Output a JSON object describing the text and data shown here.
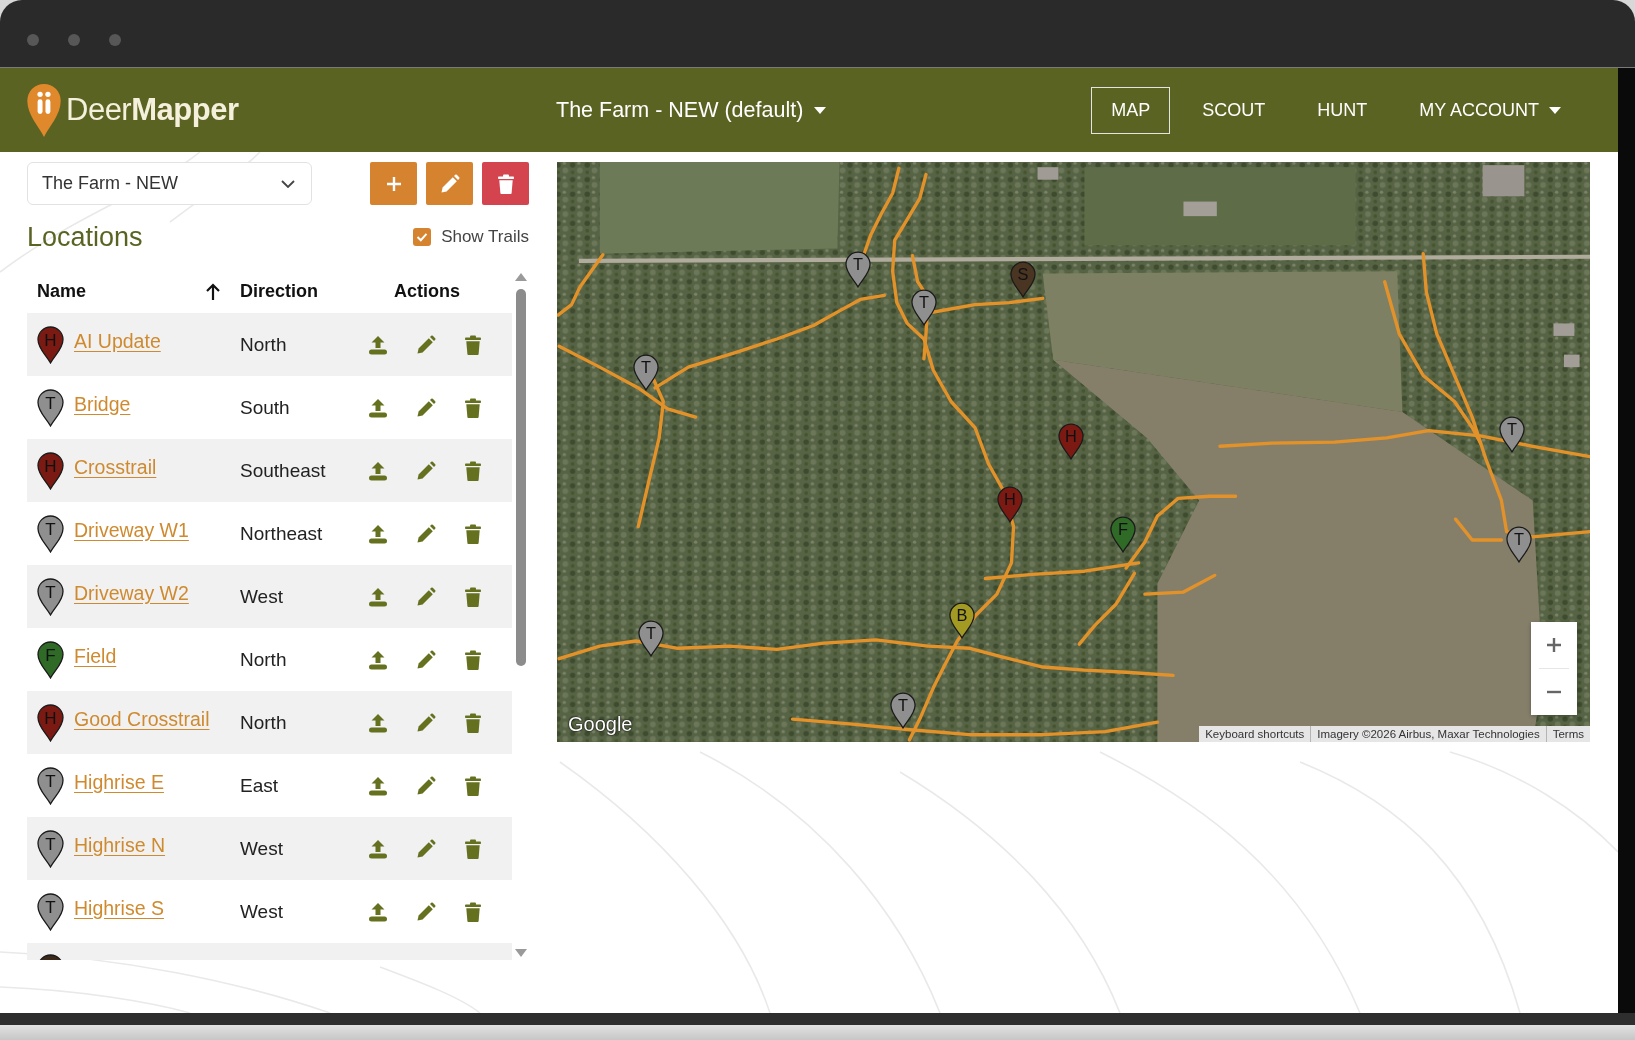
{
  "header": {
    "logo": "Deer**Mapper**",
    "property_dropdown": "The Farm - NEW (default)",
    "nav": [
      {
        "label": "MAP",
        "selected": true,
        "kind": "link"
      },
      {
        "label": "SCOUT",
        "selected": false,
        "kind": "link"
      },
      {
        "label": "HUNT",
        "selected": false,
        "kind": "link"
      },
      {
        "label": "MY ACCOUNT",
        "selected": false,
        "kind": "dropdown"
      }
    ]
  },
  "sidebar": {
    "property_select": {
      "value": "The Farm - NEW"
    },
    "title": "Locations",
    "show_trails": {
      "label": "Show Trails",
      "checked": true
    },
    "table": {
      "columns": [
        {
          "label": "Name",
          "sorted": true
        },
        {
          "label": "Direction",
          "sorted": false
        },
        {
          "label": "Actions",
          "sorted": false
        }
      ],
      "rows": [
        {
          "kind": "full",
          "marker": {
            "letter": "H",
            "color": "#7a1a12"
          },
          "name": "AI Update",
          "direction": "North"
        },
        {
          "kind": "full",
          "marker": {
            "letter": "T",
            "color": "#8f8f8f"
          },
          "name": "Bridge",
          "direction": "South"
        },
        {
          "kind": "full",
          "marker": {
            "letter": "H",
            "color": "#7a1a12"
          },
          "name": "Crosstrail",
          "direction": "Southeast"
        },
        {
          "kind": "full",
          "marker": {
            "letter": "T",
            "color": "#8f8f8f"
          },
          "name": "Driveway W1",
          "direction": "Northeast"
        },
        {
          "kind": "full",
          "marker": {
            "letter": "T",
            "color": "#8f8f8f"
          },
          "name": "Driveway W2",
          "direction": "West"
        },
        {
          "kind": "full",
          "marker": {
            "letter": "F",
            "color": "#2f6a27"
          },
          "name": "Field",
          "direction": "North"
        },
        {
          "kind": "full",
          "marker": {
            "letter": "H",
            "color": "#7a1a12"
          },
          "name": "Good Crosstrail",
          "direction": "North"
        },
        {
          "kind": "full",
          "marker": {
            "letter": "T",
            "color": "#8f8f8f"
          },
          "name": "Highrise E",
          "direction": "East"
        },
        {
          "kind": "full",
          "marker": {
            "letter": "T",
            "color": "#8f8f8f"
          },
          "name": "Highrise N",
          "direction": "West"
        },
        {
          "kind": "full",
          "marker": {
            "letter": "T",
            "color": "#8f8f8f"
          },
          "name": "Highrise S",
          "direction": "West"
        },
        {
          "kind": "partial",
          "marker": {
            "color": "#3b2a1c"
          }
        }
      ]
    }
  },
  "map": {
    "markers": [
      {
        "letter": "T",
        "color": "#8f8f8f"
      },
      {
        "letter": "S",
        "color": "#4a3422"
      },
      {
        "letter": "T",
        "color": "#8f8f8f"
      },
      {
        "letter": "T",
        "color": "#8f8f8f"
      },
      {
        "letter": "T",
        "color": "#8f8f8f"
      },
      {
        "letter": "H",
        "color": "#7a1a12"
      },
      {
        "letter": "H",
        "color": "#7a1a12"
      },
      {
        "letter": "F",
        "color": "#2f6a27"
      },
      {
        "letter": "T",
        "color": "#8f8f8f"
      },
      {
        "letter": "B",
        "color": "#a39a24"
      },
      {
        "letter": "T",
        "color": "#8f8f8f"
      },
      {
        "letter": "T",
        "color": "#8f8f8f"
      }
    ],
    "logo": "Google",
    "attribution": [
      "Keyboard shortcuts",
      "Imagery ©2026 Airbus, Maxar Technologies",
      "Terms"
    ]
  }
}
